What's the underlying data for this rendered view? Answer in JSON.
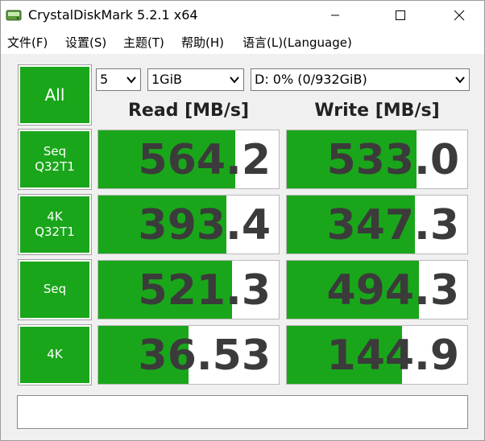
{
  "window": {
    "title": "CrystalDiskMark 5.2.1 x64"
  },
  "menu": [
    "文件(F)",
    "设置(S)",
    "主题(T)",
    "帮助(H)",
    "语言(L)(Language)"
  ],
  "controls": {
    "all_label": "All",
    "count": "5",
    "size": "1GiB",
    "drive": "D: 0% (0/932GiB)"
  },
  "headers": {
    "read": "Read [MB/s]",
    "write": "Write [MB/s]"
  },
  "tests": [
    {
      "label": "Seq\nQ32T1",
      "read": "564.2",
      "read_fill": 0.76,
      "write": "533.0",
      "write_fill": 0.72
    },
    {
      "label": "4K\nQ32T1",
      "read": "393.4",
      "read_fill": 0.71,
      "write": "347.3",
      "write_fill": 0.71
    },
    {
      "label": "Seq",
      "read": "521.3",
      "read_fill": 0.74,
      "write": "494.3",
      "write_fill": 0.73
    },
    {
      "label": "4K",
      "read": "36.53",
      "read_fill": 0.5,
      "write": "144.9",
      "write_fill": 0.64
    }
  ],
  "comment": "",
  "colors": {
    "green": "#1aa61a",
    "value_text": "#3b3b3b"
  }
}
